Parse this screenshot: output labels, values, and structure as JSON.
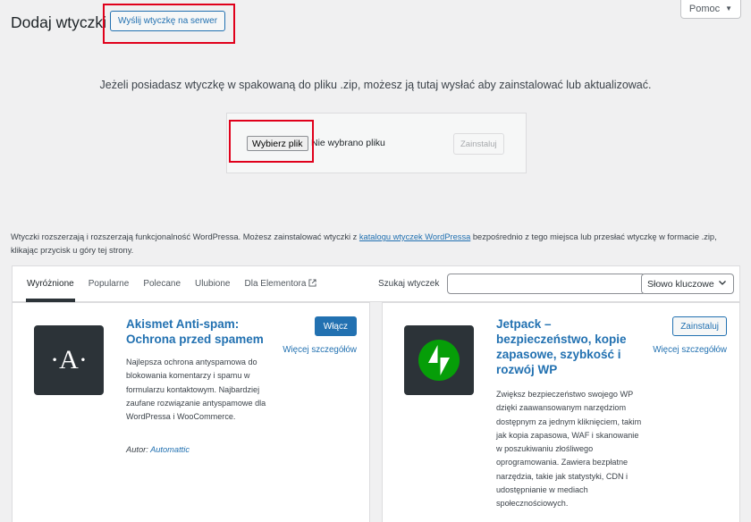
{
  "help": {
    "label": "Pomoc"
  },
  "header": {
    "title": "Dodaj wtyczki",
    "upload_button": "Wyślij wtyczkę na serwer"
  },
  "upload": {
    "intro": "Jeżeli posiadasz wtyczkę w spakowaną do pliku .zip, możesz ją tutaj wysłać aby zainstalować lub aktualizować.",
    "choose_file": "Wybierz plik",
    "no_file": "Nie wybrano pliku",
    "install": "Zainstaluj"
  },
  "description": {
    "before": "Wtyczki rozszerzają i rozszerzają funkcjonalność WordPressa. Możesz zainstalować wtyczki z ",
    "link": "katalogu wtyczek WordPressa",
    "after": " bezpośrednio z tego miejsca lub przesłać wtyczkę w formacie .zip, klikając przycisk u góry tej strony."
  },
  "filter": {
    "tabs": [
      {
        "label": "Wyróżnione"
      },
      {
        "label": "Popularne"
      },
      {
        "label": "Polecane"
      },
      {
        "label": "Ulubione"
      },
      {
        "label": "Dla Elementora"
      }
    ],
    "search_label": "Szukaj wtyczek",
    "search_value": "",
    "search_type": "Słowo kluczowe"
  },
  "plugins": [
    {
      "title": "Akismet Anti-spam: Ochrona przed spamem",
      "description": "Najlepsza ochrona antyspamowa do blokowania komentarzy i spamu w formularzu kontaktowym. Najbardziej zaufane rozwiązanie antyspamowe dla WordPressa i WooCommerce.",
      "author_label": "Autor:",
      "author": "Automattic",
      "action": "Włącz",
      "more": "Więcej szczegółów",
      "icon": "akismet-icon",
      "icon_letter": "·A·"
    },
    {
      "title": "Jetpack – bezpieczeństwo, kopie zapasowe, szybkość i rozwój WP",
      "description": "Zwiększ bezpieczeństwo swojego WP dzięki zaawansowanym narzędziom dostępnym za jednym kliknięciem, takim jak kopia zapasowa, WAF i skanowanie w poszukiwaniu złośliwego oprogramowania. Zawiera bezpłatne narzędzia, takie jak statystyki, CDN i udostępnianie w mediach społecznościowych.",
      "action": "Zainstaluj",
      "more": "Więcej szczegółów",
      "icon": "jetpack-icon"
    }
  ],
  "colors": {
    "accent": "#2271b1",
    "highlight": "#e0001b",
    "jetpack_green": "#069e08",
    "icon_bg": "#2c3338"
  }
}
